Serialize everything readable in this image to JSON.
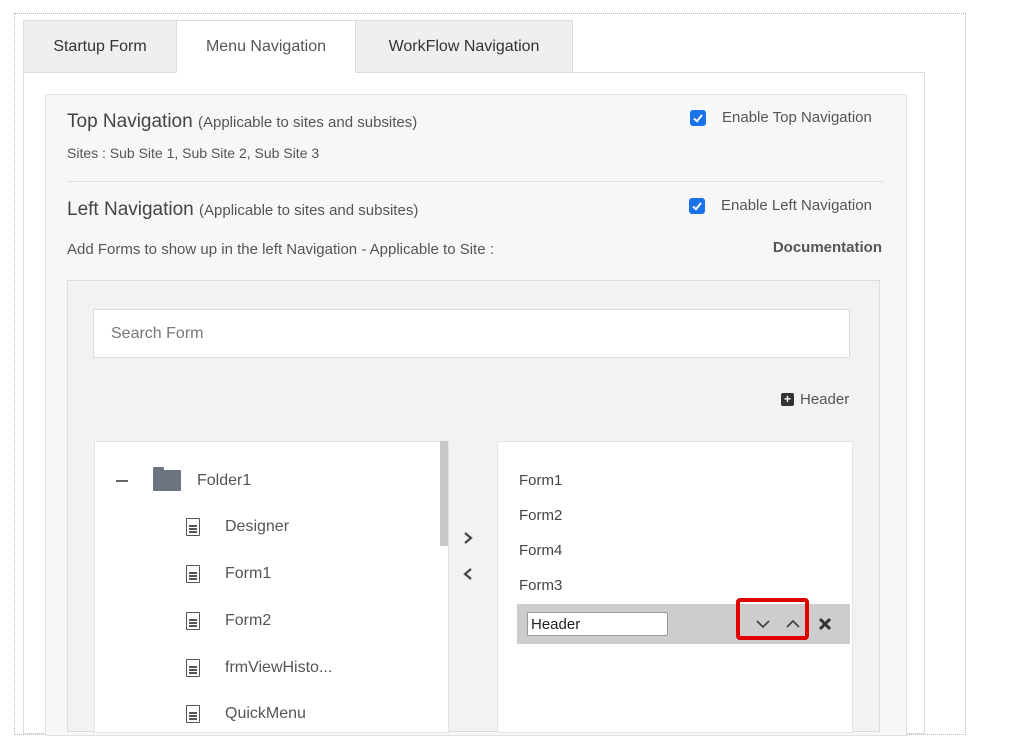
{
  "tabs": [
    {
      "label": "Startup Form"
    },
    {
      "label": "Menu Navigation",
      "active": true
    },
    {
      "label": "WorkFlow Navigation"
    }
  ],
  "top_navigation": {
    "title": "Top Navigation",
    "note": "(Applicable to sites and subsites)",
    "sites": "Sites : Sub Site 1, Sub Site 2, Sub Site 3",
    "enable_label": "Enable Top Navigation",
    "enabled": true
  },
  "left_navigation": {
    "title": "Left Navigation",
    "note": "(Applicable to sites and subsites)",
    "description": "Add Forms to show up in the left Navigation - Applicable to Site :",
    "site_name": "Documentation",
    "enable_label": "Enable Left Navigation",
    "enabled": true
  },
  "search": {
    "placeholder": "Search Form"
  },
  "add_header_label": "Header",
  "tree": {
    "folder": "Folder1",
    "files": [
      "Designer",
      "Form1",
      "Form2",
      "frmViewHisto...",
      "QuickMenu"
    ]
  },
  "selected_forms": [
    "Form1",
    "Form2",
    "Form4",
    "Form3"
  ],
  "header_item": {
    "value": "Header"
  },
  "colors": {
    "accent": "#1a73e8",
    "highlight": "#e00000"
  },
  "icons": [
    "folder-icon",
    "file-icon",
    "chevron-right-icon",
    "chevron-left-icon",
    "chevron-down-icon",
    "chevron-up-icon",
    "close-icon",
    "plus-square-icon",
    "checkbox-checked-icon",
    "collapse-icon"
  ]
}
